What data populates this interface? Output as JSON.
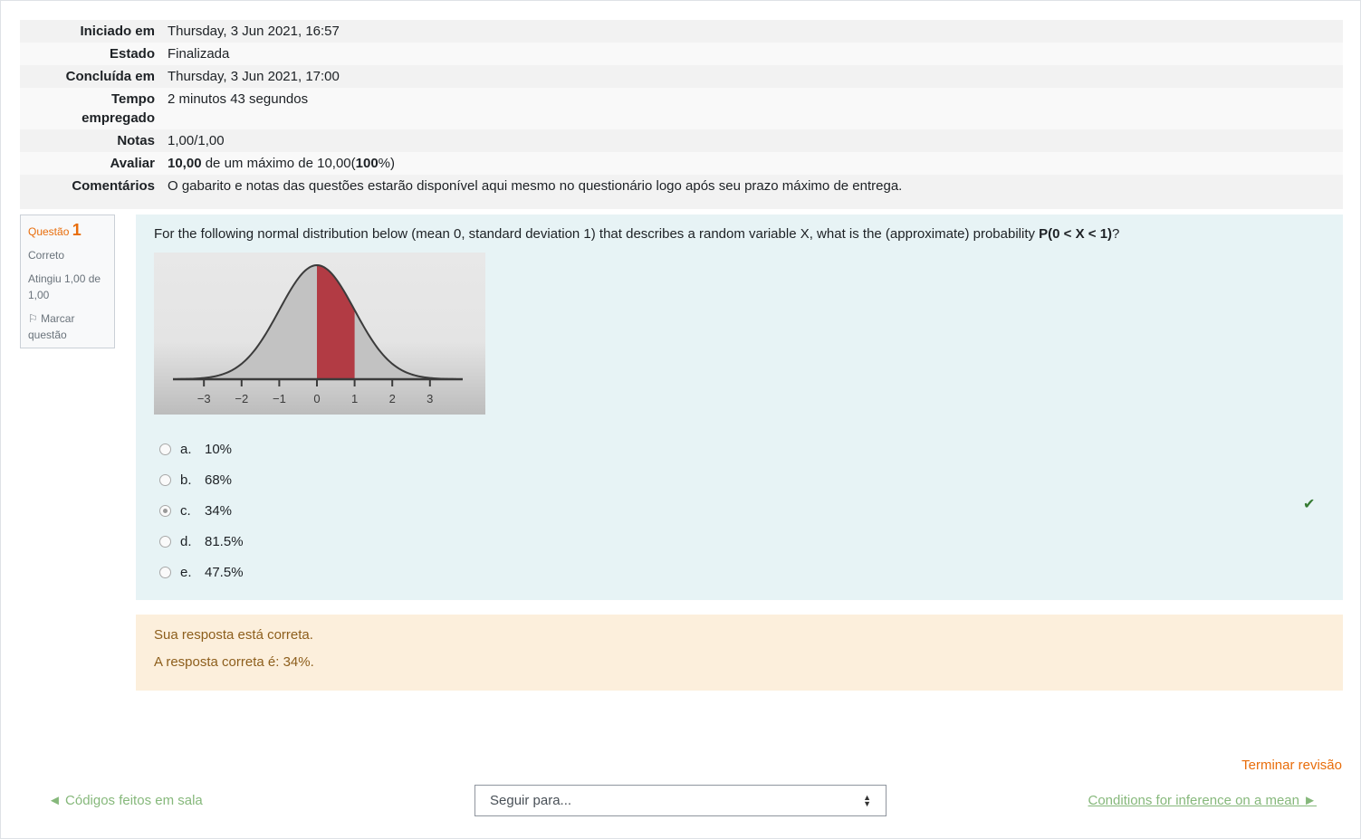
{
  "summary": [
    {
      "label": "Iniciado em",
      "value": "Thursday, 3 Jun 2021, 16:57"
    },
    {
      "label": "Estado",
      "value": "Finalizada"
    },
    {
      "label": "Concluída em",
      "value": "Thursday, 3 Jun 2021, 17:00"
    },
    {
      "label": "Tempo empregado",
      "value": "2 minutos 43 segundos"
    },
    {
      "label": "Notas",
      "value": "1,00/1,00"
    },
    {
      "label": "Avaliar",
      "value_bold": "10,00",
      "value_mid": " de um máximo de 10,00(",
      "value_pct": "100",
      "value_end": "%)"
    },
    {
      "label": "Comentários",
      "value": "O gabarito e notas das questões estarão disponível aqui mesmo no questionário logo após seu prazo máximo de entrega."
    }
  ],
  "question_info": {
    "prefix": "Questão",
    "number": "1",
    "state": "Correto",
    "grade": "Atingiu 1,00 de 1,00",
    "flag": "Marcar questão"
  },
  "question": {
    "text": "For the following normal distribution below (mean 0, standard deviation 1) that describes a random variable X, what is the (approximate) probability ",
    "text_bold": "P(0 < X < 1)",
    "text_end": "?"
  },
  "chart_data": {
    "type": "area",
    "x_ticks": [
      "-3",
      "-2",
      "-1",
      "0",
      "1",
      "2",
      "3"
    ],
    "shaded_interval": [
      0,
      1
    ],
    "colors": {
      "curve_fill": "#c2c2c2",
      "shaded": "#b23b44",
      "axis": "#3b3b3b"
    }
  },
  "answers": [
    {
      "letter": "a.",
      "text": "10%",
      "checked": false
    },
    {
      "letter": "b.",
      "text": "68%",
      "checked": false
    },
    {
      "letter": "c.",
      "text": "34%",
      "checked": true
    },
    {
      "letter": "d.",
      "text": "81.5%",
      "checked": false
    },
    {
      "letter": "e.",
      "text": "47.5%",
      "checked": false
    }
  ],
  "feedback": {
    "line1": "Sua resposta está correta.",
    "line2": "A resposta correta é: 34%."
  },
  "nav": {
    "finish": "Terminar revisão",
    "prev": "◄ Códigos feitos em sala",
    "jump": "Seguir para...",
    "next": "Conditions for inference on a mean ►"
  }
}
